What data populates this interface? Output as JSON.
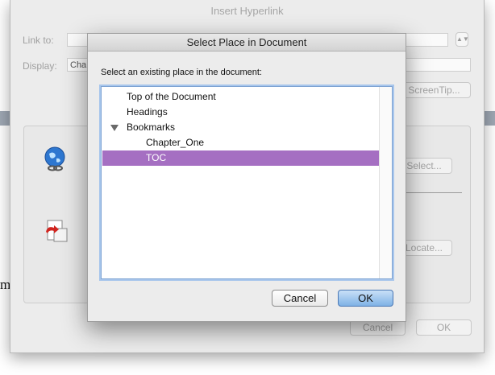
{
  "background_document": {
    "visible_letter": "m"
  },
  "outer_dialog": {
    "title": "Insert Hyperlink",
    "link_to_label": "Link to:",
    "display_label": "Display:",
    "display_value": "Cha",
    "screentip_button": "ScreenTip...",
    "select_button": "Select...",
    "locate_button": "Locate...",
    "cancel_button": "Cancel",
    "ok_button": "OK",
    "icons": [
      "globe-link-icon",
      "document-link-icon"
    ]
  },
  "inner_dialog": {
    "title": "Select Place in Document",
    "prompt": "Select an existing place in the document:",
    "items": [
      {
        "label": "Top of the Document",
        "level": 0,
        "selected": false
      },
      {
        "label": "Headings",
        "level": 0,
        "selected": false
      },
      {
        "label": "Bookmarks",
        "level": 0,
        "expanded": true,
        "selected": false
      },
      {
        "label": "Chapter_One",
        "level": 1,
        "selected": false
      },
      {
        "label": "TOC",
        "level": 1,
        "selected": true
      }
    ],
    "cancel_button": "Cancel",
    "ok_button": "OK",
    "selection_color": "#a56fc2",
    "default_button_color": "#7fb2e6"
  }
}
